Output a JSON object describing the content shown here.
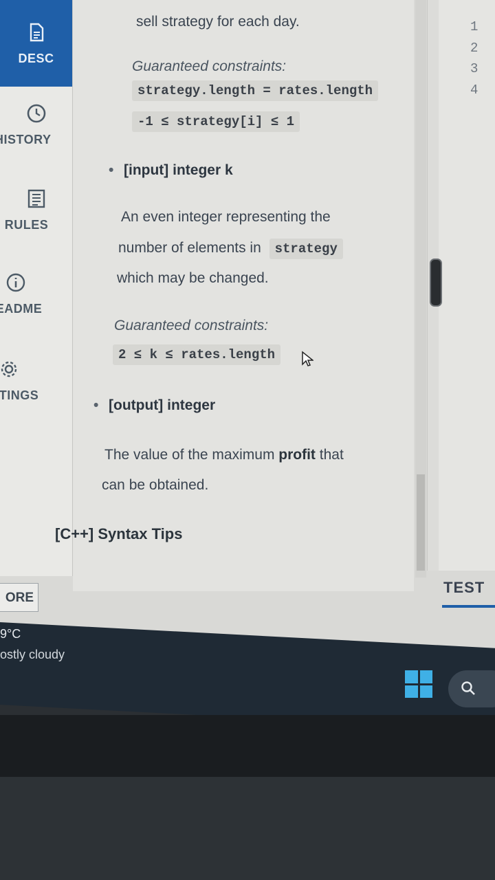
{
  "sidebar": {
    "items": [
      {
        "label": "DESC",
        "icon": "document-icon",
        "active": true
      },
      {
        "label": "HISTORY",
        "icon": "clock-icon"
      },
      {
        "label": "RULES",
        "icon": "list-icon"
      },
      {
        "label": "EADME",
        "icon": "info-icon"
      },
      {
        "label": "TINGS",
        "icon": "gear-icon"
      }
    ],
    "more_label": "ORE"
  },
  "description": {
    "intro": "sell strategy for each day.",
    "constraints_heading_1": "Guaranteed constraints:",
    "constraint_1a": "strategy.length = rates.length",
    "constraint_1b": "-1 ≤ strategy[i] ≤ 1",
    "input_k_label": "[input] integer k",
    "input_k_desc_1": "An even integer representing the",
    "input_k_desc_2a": "number of elements in",
    "input_k_desc_2b": "strategy",
    "input_k_desc_3": "which may be changed.",
    "constraints_heading_2": "Guaranteed constraints:",
    "constraint_2": "2 ≤ k ≤ rates.length",
    "output_label": "[output] integer",
    "output_desc_1a": "The value of the maximum",
    "output_desc_1b": "profit",
    "output_desc_1c": "that",
    "output_desc_2": "can be obtained.",
    "syntax_tips": "[C++] Syntax Tips"
  },
  "editor": {
    "line_numbers": [
      "1",
      "2",
      "3",
      "4"
    ],
    "test_tab": "TEST"
  },
  "taskbar": {
    "temperature": "9°C",
    "weather": "ostly cloudy"
  },
  "colors": {
    "accent": "#1f5fa8",
    "windows_logo": "#3fb0e6"
  }
}
